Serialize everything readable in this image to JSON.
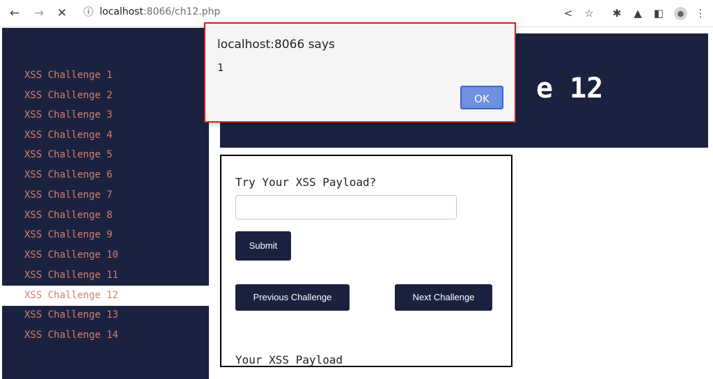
{
  "browser": {
    "back_icon": "←",
    "forward_icon": "→",
    "stop_icon": "✕",
    "info_icon": "ⓘ",
    "url_host": "localhost",
    "url_path": ":8066/ch12.php",
    "share_icon": "<",
    "star_icon": "☆",
    "extension_icon": "✱",
    "lab_icon": "▲",
    "sidepanel_icon": "◧",
    "profile_icon": "●",
    "menu_icon": "⋮"
  },
  "sidebar": {
    "items": [
      {
        "label": "XSS Challenge 1"
      },
      {
        "label": "XSS Challenge 2"
      },
      {
        "label": "XSS Challenge 3"
      },
      {
        "label": "XSS Challenge 4"
      },
      {
        "label": "XSS Challenge 5"
      },
      {
        "label": "XSS Challenge 6"
      },
      {
        "label": "XSS Challenge 7"
      },
      {
        "label": "XSS Challenge 8"
      },
      {
        "label": "XSS Challenge 9"
      },
      {
        "label": "XSS Challenge 10"
      },
      {
        "label": "XSS Challenge 11"
      },
      {
        "label": "XSS Challenge 12"
      },
      {
        "label": "XSS Challenge 13"
      },
      {
        "label": "XSS Challenge 14"
      }
    ],
    "active": "XSS Challenge 12"
  },
  "banner": {
    "visible_title": "e 12"
  },
  "form": {
    "prompt": "Try Your XSS Payload?",
    "input_value": "",
    "submit_label": "Submit",
    "prev_label": "Previous Challenge",
    "next_label": "Next Challenge",
    "result_label": "Your XSS Payload"
  },
  "dialog": {
    "title": "localhost:8066 says",
    "message": "1",
    "ok_label": "OK"
  },
  "colors": {
    "navy": "#1b2240",
    "sidebar_text": "#d3806a",
    "dialog_border": "#d32020",
    "ok_button": "#6f8fdf"
  }
}
